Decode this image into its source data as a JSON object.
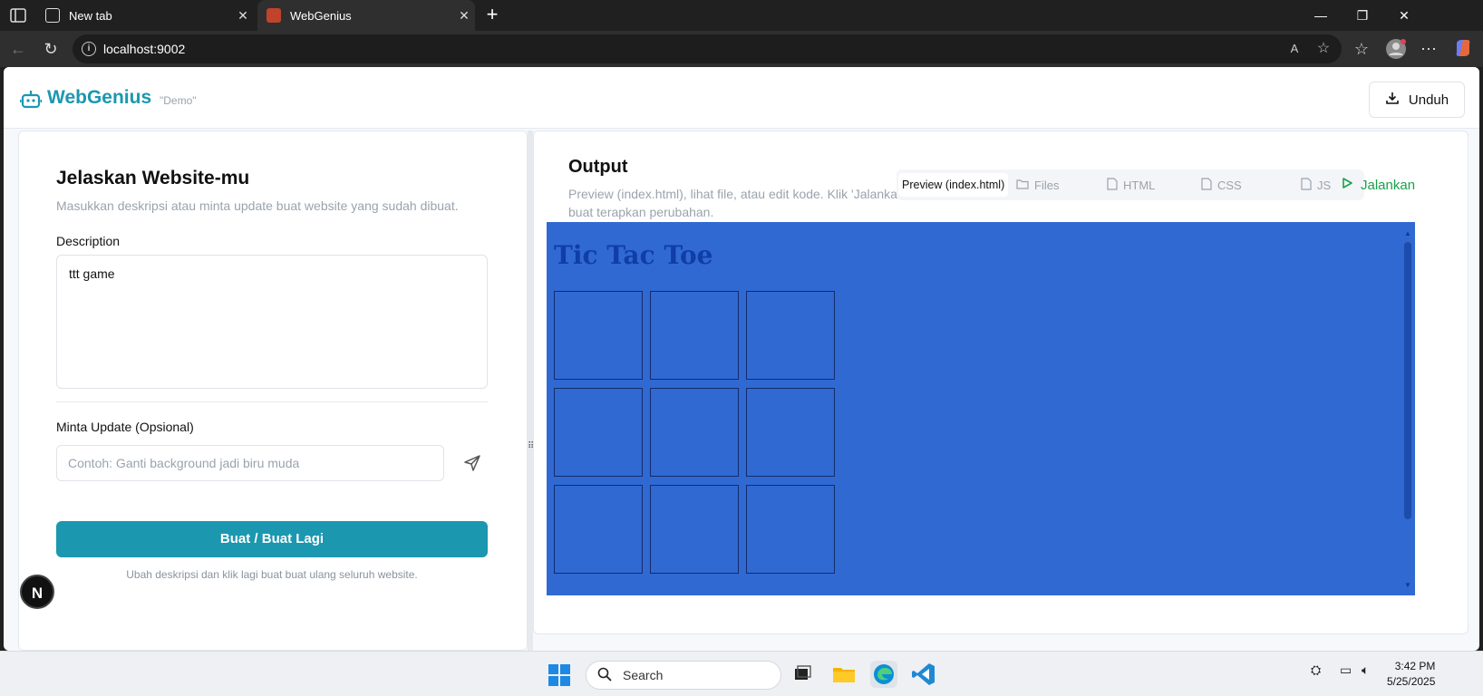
{
  "browser": {
    "tabs": [
      {
        "title": "New tab",
        "active": false
      },
      {
        "title": "WebGenius",
        "active": true
      }
    ],
    "url": "localhost:9002"
  },
  "header": {
    "brand": "WebGenius",
    "tag": "\"Demo\"",
    "download_label": "Unduh"
  },
  "left": {
    "title": "Jelaskan Website-mu",
    "subtitle": "Masukkan deskripsi atau minta update buat website yang sudah dibuat.",
    "description_label": "Description",
    "description_value": "ttt game",
    "update_label": "Minta Update (Opsional)",
    "update_placeholder": "Contoh: Ganti background jadi biru muda",
    "build_label": "Buat / Buat Lagi",
    "build_hint": "Ubah deskripsi dan klik lagi buat buat ulang seluruh website.",
    "badge": "N"
  },
  "right": {
    "title": "Output",
    "subtitle": "Preview (index.html), lihat file, atau edit kode. Klik 'Jalankan' buat terapkan perubahan.",
    "tabs": [
      "Preview (index.html)",
      "Files",
      "HTML",
      "CSS",
      "JS"
    ],
    "run_label": "Jalankan",
    "preview_title": "Tic Tac Toe",
    "preview_cells": 9
  },
  "taskbar": {
    "search_placeholder": "Search",
    "time": "3:42 PM",
    "date": "5/25/2025"
  },
  "colors": {
    "accent": "#1b97b0",
    "run": "#16a34a",
    "preview_bg": "#3169d3"
  }
}
